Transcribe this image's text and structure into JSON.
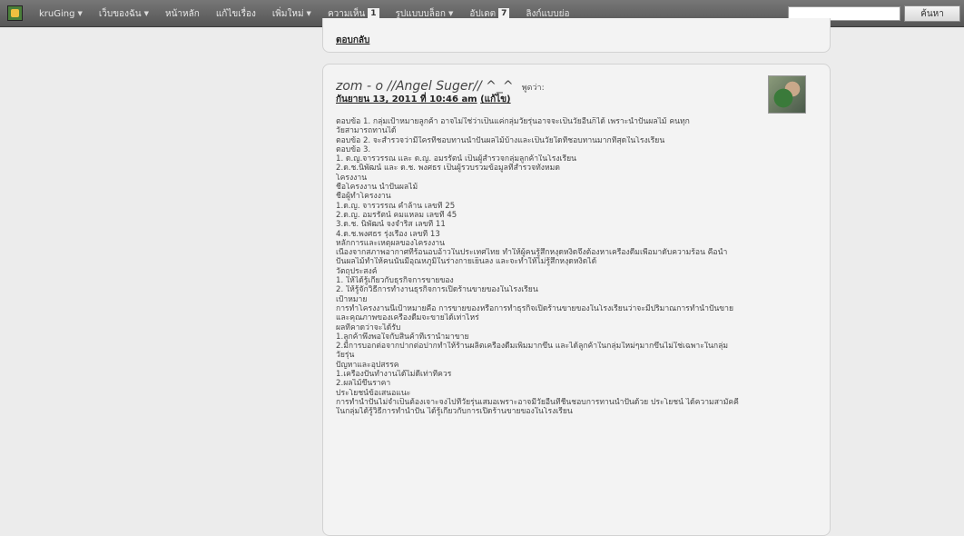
{
  "navbar": {
    "items": [
      {
        "label": "kruGing",
        "caret": "▼"
      },
      {
        "label": "เว็บของฉัน",
        "caret": "▼"
      },
      {
        "label": "หน้าหลัก"
      },
      {
        "label": "แก้ไขเรื่อง"
      },
      {
        "label": "เพิ่มใหม่",
        "caret": "▼"
      },
      {
        "label": "ความเห็น",
        "badge": "1"
      },
      {
        "label": "รูปแบบบล็อก",
        "caret": "▼"
      },
      {
        "label": "อัปเดต",
        "badge": "7"
      },
      {
        "label": "ลิงก์แบบย่อ"
      }
    ],
    "search_value": "",
    "search_button": "ค้นหา"
  },
  "previous_comment": {
    "reply_link": "ตอบกลับ"
  },
  "comment": {
    "author": "zom - o //Angel Suger// ^_^",
    "says": "พูดว่า:",
    "date": "กันยายน 13, 2011 ที่ 10:46 am",
    "edit": "(แก้ไข)",
    "lines": [
      "ตอบข้อ 1. กลุ่มเป้าหมายลูกค้า อาจไม่ใช่ว่าเป็นแค่กลุ่มวัยรุ่นอาจจะเป็นวัยอื่นก็ได้ เพราะน้ำปั่นผลไม้ คนทุก",
      "วัยสามารถทานได้",
      "ตอบข้อ 2. จะสำรวจว่ามีใครที่ชอบทานน้ำปั่นผลไม้บ้างและเป็นวัยใดที่ชอบทานมากที่สุดในโรงเรียน",
      "ตอบข้อ 3.",
      "1. ด.ญ.จารวรรณ และ ด.ญ. อมรรัตน์ เป็นผู้สำรวจกลุ่มลูกค้าในโรงเรียน",
      "2.ด.ช.นิพัฒน์ และ ด.ช. พงศธร เป็นผู้รวบรวมข้อมูลที่สำรวจทั้งหมด",
      "โครงงาน",
      "ชื่อโครงงาน น้ำปั่นผลไม้",
      "ชื่อผู้ทำโครงงาน",
      "1.ด.ญ. จารวรรณ คำล้าน เลขที่ 25",
      "2.ด.ญ. อมรรัตน์ คมแหลม เลขที่ 45",
      "3.ด.ช. นิพัฒน์ จงจำริส เลขที่ 11",
      "4.ด.ช.พงศธร รุ่งเรือง เลขที่ 13",
      "หลักการและเหตุผลของโครงงาน",
      "เนื่องจากสภาพอากาศที่ร้อนอบอ้าวในประเทศไทย ทำให้ผู้คนรู้สึกหงุดหงิดจึงต้องหาเครื่องดื่มเพื่อมาดับความร้อน คือน้ำ",
      "ปั่นผลไม้ทำให้คนนั้นมีอุณหภูมิในร่างกายเย็นลง และจะทำให้ไม่รู้สึกหงุดหงิดได้",
      "วัตถุประสงค์",
      "1. ให้ได้รู้เกี่ยวกับธุรกิจการขายของ",
      "2. ให้รู้จักวิธีการทำงานธุรกิจการเปิดร้านขายของในโรงเรียน",
      "เป้าหมาย",
      "การทำโครงงานนี้เป้าหมายคือ การขายของหรือการทำธุรกิจเปิดร้านขายของในโรงเรียนว่าจะมีปริมาณการทำน้ำปั่นขาย",
      "และคุณภาพของเครื่องดื่มจะขายได้เท่าไหร่",
      "ผลที่คาดว่าจะได้รับ",
      "1.ลูกค้าพึงพอใจกับสินค้าที่เรานำมาขาย",
      "2.มีการบอกต่อจากปากต่อปากทำให้ร้านผลิตเครื่องดื่มเพิ่มมากขึ้น และได้ลูกค้าในกลุ่มใหม่ๆมากขึ้นไม่ใช่เฉพาะในกลุ่ม",
      "วัยรุ่น",
      "ปัญหาและอุปสรรค",
      "1.เครื่องปั่นทำงานได้ไม่ดีเท่าที่ควร",
      "2.ผลไม้ขึ้นราคา",
      "ประโยชน์ข้อเสนอแนะ",
      "การทำน้ำปั่นไม่จำเป็นต้องเจาะจงไปที่วัยรุ่นเสมอเพราะอาจมีวัยอื่นที่ชื่นชอบการทานน้ำปั่นด้วย ประโยชน์ ได้ความสามัคคี",
      "ในกลุ่มได้รู้วิธีการทำน้ำปั่น ได้รู้เกี่ยวกับการเปิดร้านขายของในโรงเรียน"
    ]
  }
}
